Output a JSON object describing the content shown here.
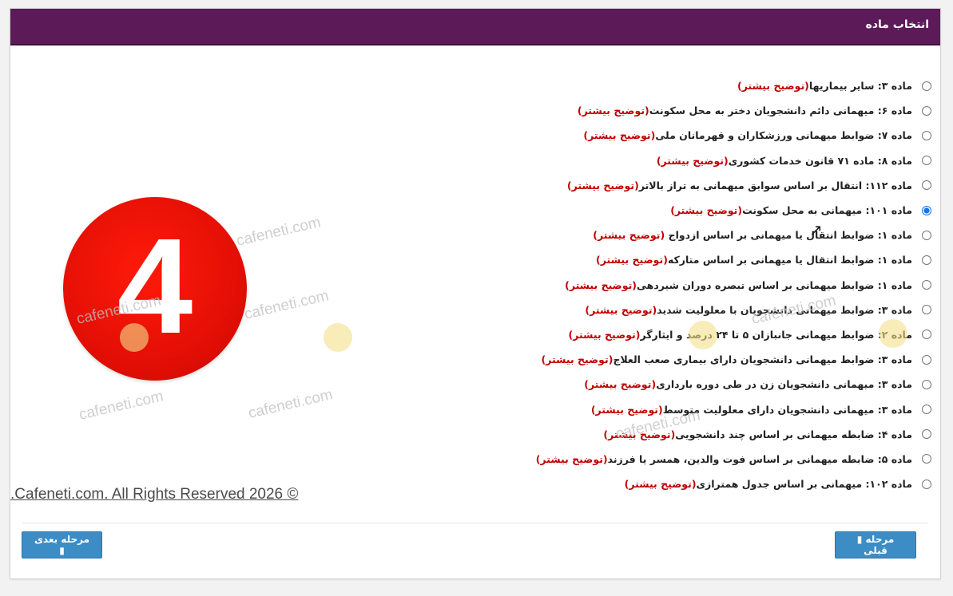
{
  "header": {
    "title": "انتخاب ماده"
  },
  "options": [
    {
      "text": "ماده ۳: سایر بیماریها",
      "more": "(توضیح بیشتر)",
      "checked": false
    },
    {
      "text": "ماده ۶: میهمانی دائم دانشجویان دختر به محل سکونت",
      "more": "(توضیح بیشتر)",
      "checked": false
    },
    {
      "text": "ماده ۷: ضوابط میهمانی ورزشکاران و قهرمانان ملی",
      "more": "(توضیح بیشتر)",
      "checked": false
    },
    {
      "text": "ماده ۸: ماده ۷۱ قانون خدمات کشوری",
      "more": "(توضیح بیشتر)",
      "checked": false
    },
    {
      "text": "ماده ۱۱۲: انتقال بر اساس سوابق میهمانی به تراز بالاتر",
      "more": "(توضیح بیشتر)",
      "checked": false
    },
    {
      "text": "ماده ۱۰۱: میهمانی به محل سکونت",
      "more": "(توضیح بیشتر)",
      "checked": true
    },
    {
      "text": "ماده ۱: ضوابط انتقال یا میهمانی بر اساس ازدواج ",
      "more": "(توضیح بیشتر)",
      "checked": false
    },
    {
      "text": "ماده ۱: ضوابط انتقال یا میهمانی بر اساس متارکه",
      "more": "(توضیح بیشتر)",
      "checked": false
    },
    {
      "text": "ماده ۱: ضوابط میهمانی بر اساس تبصره دوران شیردهی",
      "more": "(توضیح بیشتر)",
      "checked": false
    },
    {
      "text": "ماده ۳: ضوابط میهمانی دانشجویان با معلولیت شدید",
      "more": "(توضیح بیشتر)",
      "checked": false
    },
    {
      "text": "ماده ۲: ضوابط میهمانی جانبازان ۵ تا ۲۴ درصد و ایثارگر",
      "more": "(توضیح بیشتر)",
      "checked": false
    },
    {
      "text": "ماده ۳: ضوابط میهمانی دانشجویان دارای بیماری صعب العلاج",
      "more": "(توضیح بیشتر)",
      "checked": false
    },
    {
      "text": "ماده ۳: میهمانی دانشجویان زن در طی دوره بارداری",
      "more": "(توضیح بیشتر)",
      "checked": false
    },
    {
      "text": "ماده ۳: میهمانی دانشجویان دارای معلولیت متوسط",
      "more": "(توضیح بیشتر)",
      "checked": false
    },
    {
      "text": "ماده ۴: ضابطه میهمانی بر اساس چند دانشجویی",
      "more": "(توضیح بیشتر)",
      "checked": false
    },
    {
      "text": "ماده ۵: ضابطه میهمانی بر اساس فوت والدین، همسر یا فرزند",
      "more": "(توضیح بیشتر)",
      "checked": false
    },
    {
      "text": "ماده ۱۰۲: میهمانی بر اساس جدول همترازی",
      "more": "(توضیح بیشتر)",
      "checked": false
    }
  ],
  "badge": {
    "number": "4",
    "color": "#e40f05"
  },
  "copyright": ".Cafeneti.com. All Rights Reserved 2026 ©",
  "buttons": {
    "next_label": "مرحله بعدی",
    "next_icon": "chevron-icon",
    "prev_label": "مرحله قبلی",
    "prev_icon": "chevron-icon"
  },
  "watermark": "cafeneti.com",
  "colors": {
    "header": "#5c1a58",
    "button": "#3c8dc6",
    "link": "#c00000"
  }
}
